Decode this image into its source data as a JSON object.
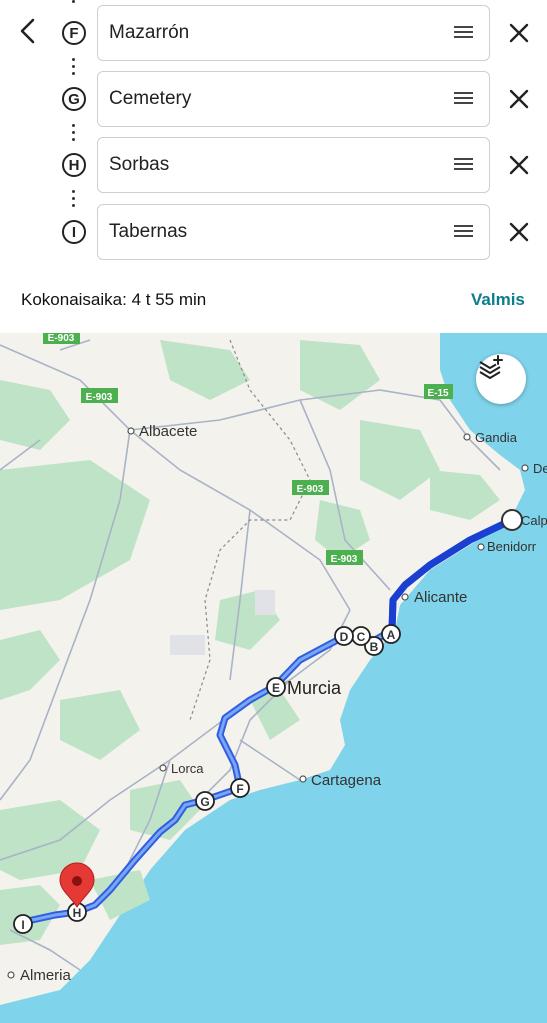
{
  "header": {
    "back_icon": "chevron-left-icon"
  },
  "stops": [
    {
      "letter": "F",
      "name": "Mazarrón"
    },
    {
      "letter": "G",
      "name": "Cemetery"
    },
    {
      "letter": "H",
      "name": "Sorbas"
    },
    {
      "letter": "I",
      "name": "Tabernas"
    }
  ],
  "summary": {
    "total_time": "Kokonaisaika: 4 t 55 min",
    "done_label": "Valmis"
  },
  "map": {
    "roads": [
      "E-903",
      "E-903",
      "E-903",
      "E-903",
      "E-15"
    ],
    "cities": [
      "Albacete",
      "Gandia",
      "De",
      "Calp",
      "Benidorr",
      "Alicante",
      "Murcia",
      "Lorca",
      "Cartagena",
      "Almeria"
    ],
    "waypoints": [
      "A",
      "B",
      "C",
      "D",
      "E",
      "F",
      "G",
      "H",
      "I"
    ],
    "route_color": "#2f5fe0",
    "sea_color": "#7fd3ea",
    "pin_color": "#e53935"
  }
}
